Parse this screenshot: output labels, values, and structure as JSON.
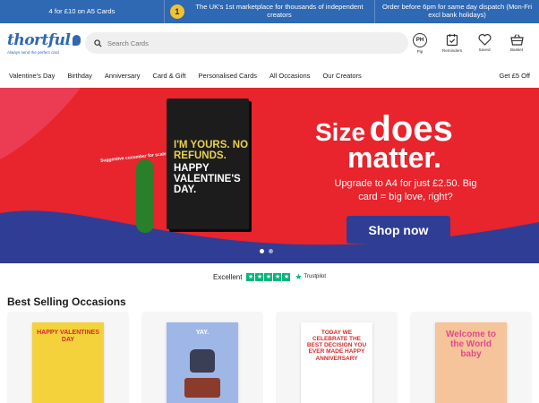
{
  "promo": {
    "left": "4 for £10 on A5 Cards",
    "middle": "The UK's 1st marketplace for thousands of independent creators",
    "middle_badge": "1",
    "right": "Order before 6pm for same day dispatch (Mon-Fri excl bank holidays)"
  },
  "header": {
    "logo_text": "thortful",
    "logo_tagline": "Always send the perfect card",
    "search_placeholder": "Search Cards",
    "icons": [
      {
        "name": "profile-icon",
        "label": "Pip",
        "badge": "PH"
      },
      {
        "name": "reminders-icon",
        "label": "Reminders"
      },
      {
        "name": "heart-icon",
        "label": "Saved"
      },
      {
        "name": "basket-icon",
        "label": "Basket"
      }
    ]
  },
  "nav": {
    "items": [
      "Valentine's Day",
      "Birthday",
      "Anniversary",
      "Card & Gift",
      "Personalised Cards",
      "All Occasions",
      "Our Creators"
    ],
    "right": "Get £5 Off"
  },
  "hero": {
    "card_line1": "I'M YOURS. NO REFUNDS.",
    "card_line2": "HAPPY VALENTINE'S DAY.",
    "cucumber_note": "Suggestive cucumber for scale",
    "heading_a": "Size",
    "heading_b": "does",
    "heading_c": "matter.",
    "subtext": "Upgrade to A4 for just £2.50. Big card = big love, right?",
    "cta": "Shop now",
    "bg_color": "#e8242d",
    "accent": "#2f3e94"
  },
  "trust": {
    "rating": "Excellent",
    "brand": "Trustpilot"
  },
  "best_selling": {
    "title": "Best Selling Occasions",
    "cards": [
      {
        "text": "HAPPY VALENTINES DAY",
        "bg": "#f4d23c",
        "color": "#d62a2a"
      },
      {
        "text": "YAY.",
        "bg": "#9fb7e6",
        "color": "#ffffff"
      },
      {
        "text": "TODAY WE CELEBRATE THE BEST DECISION YOU EVER MADE HAPPY ANNIVERSARY",
        "bg": "#ffffff",
        "color": "#d62a2a"
      },
      {
        "text": "Welcome to the World baby",
        "bg": "#f5c49a",
        "color": "#e24b8a"
      }
    ]
  }
}
